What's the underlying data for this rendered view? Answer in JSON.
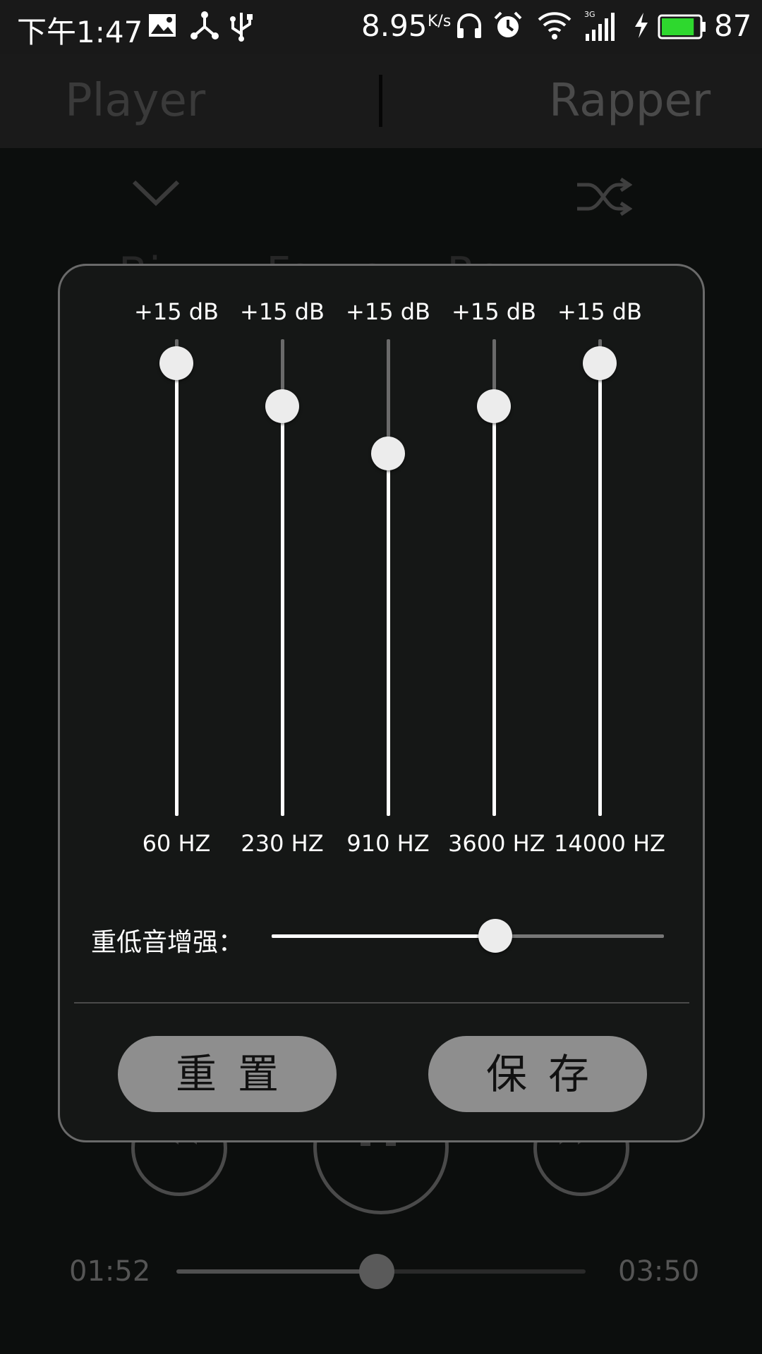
{
  "status_bar": {
    "time": "下午1:47",
    "net_speed": "8.95",
    "net_speed_unit": "K/s",
    "network_type": "3G",
    "battery_percent": "87",
    "battery_level": 0.87,
    "icons": [
      "image-icon",
      "share-icon",
      "usb-icon",
      "headphones-icon",
      "alarm-icon",
      "wifi-icon",
      "signal-icon",
      "charging-icon",
      "battery-icon"
    ]
  },
  "tabs": [
    {
      "label": "Player"
    },
    {
      "label": "Rapper"
    }
  ],
  "background": {
    "ghost_title": "Bi... ...Fa...a ...Re...",
    "current_time": "01:52",
    "total_time": "03:50",
    "progress": 0.49
  },
  "equalizer": {
    "bands": [
      {
        "db_label": "+15 dB",
        "freq_label": "60 HZ",
        "level": 0.95
      },
      {
        "db_label": "+15 dB",
        "freq_label": "230 HZ",
        "level": 0.86
      },
      {
        "db_label": "+15 dB",
        "freq_label": "910 HZ",
        "level": 0.76
      },
      {
        "db_label": "+15 dB",
        "freq_label": "3600 HZ",
        "level": 0.86
      },
      {
        "db_label": "+15 dB",
        "freq_label": "14000 HZ",
        "level": 0.95
      }
    ],
    "bass_boost_label": "重低音增强：",
    "bass_boost_level": 0.57,
    "reset_label": "重置",
    "save_label": "保存"
  }
}
